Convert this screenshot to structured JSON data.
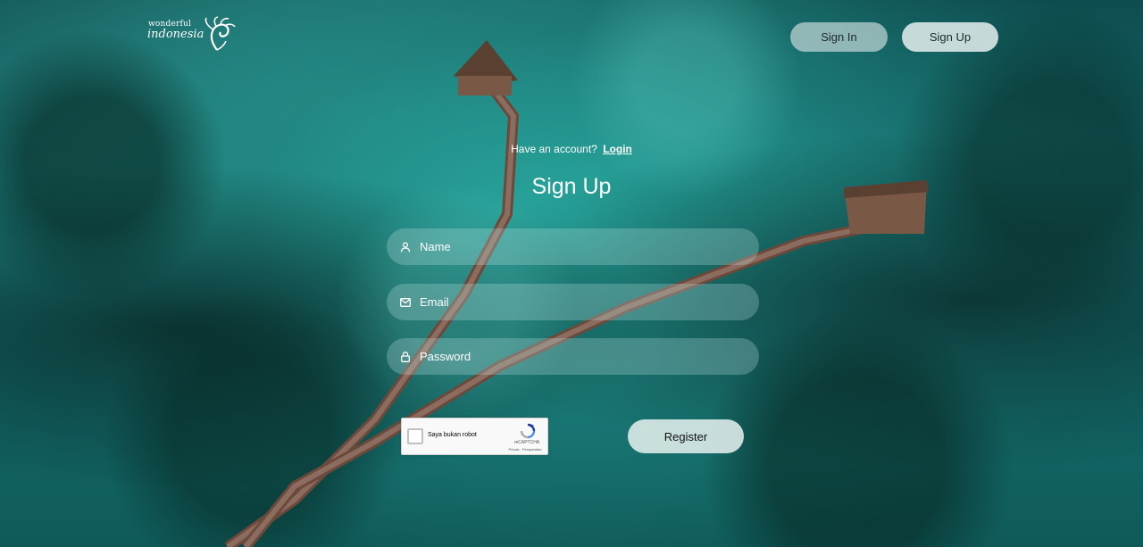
{
  "logo": {
    "small_text": "wonderful",
    "big_text": "indonesia",
    "bird_icon": "garuda-bird-icon"
  },
  "nav": {
    "signin_label": "Sign In",
    "signup_label": "Sign Up"
  },
  "have_account": {
    "text": "Have an account?",
    "link_label": "Login"
  },
  "title": "Sign Up",
  "form": {
    "name": {
      "placeholder": "Name",
      "icon": "user-icon"
    },
    "email": {
      "placeholder": "Email",
      "icon": "mail-icon"
    },
    "password": {
      "placeholder": "Password",
      "icon": "lock-icon"
    }
  },
  "captcha": {
    "label": "Saya bukan robot",
    "brand": "reCAPTCHA",
    "links": "Privasi - Persyaratan"
  },
  "register_label": "Register",
  "colors": {
    "accent_button": "#e1eeec",
    "sea": "#17787a"
  }
}
